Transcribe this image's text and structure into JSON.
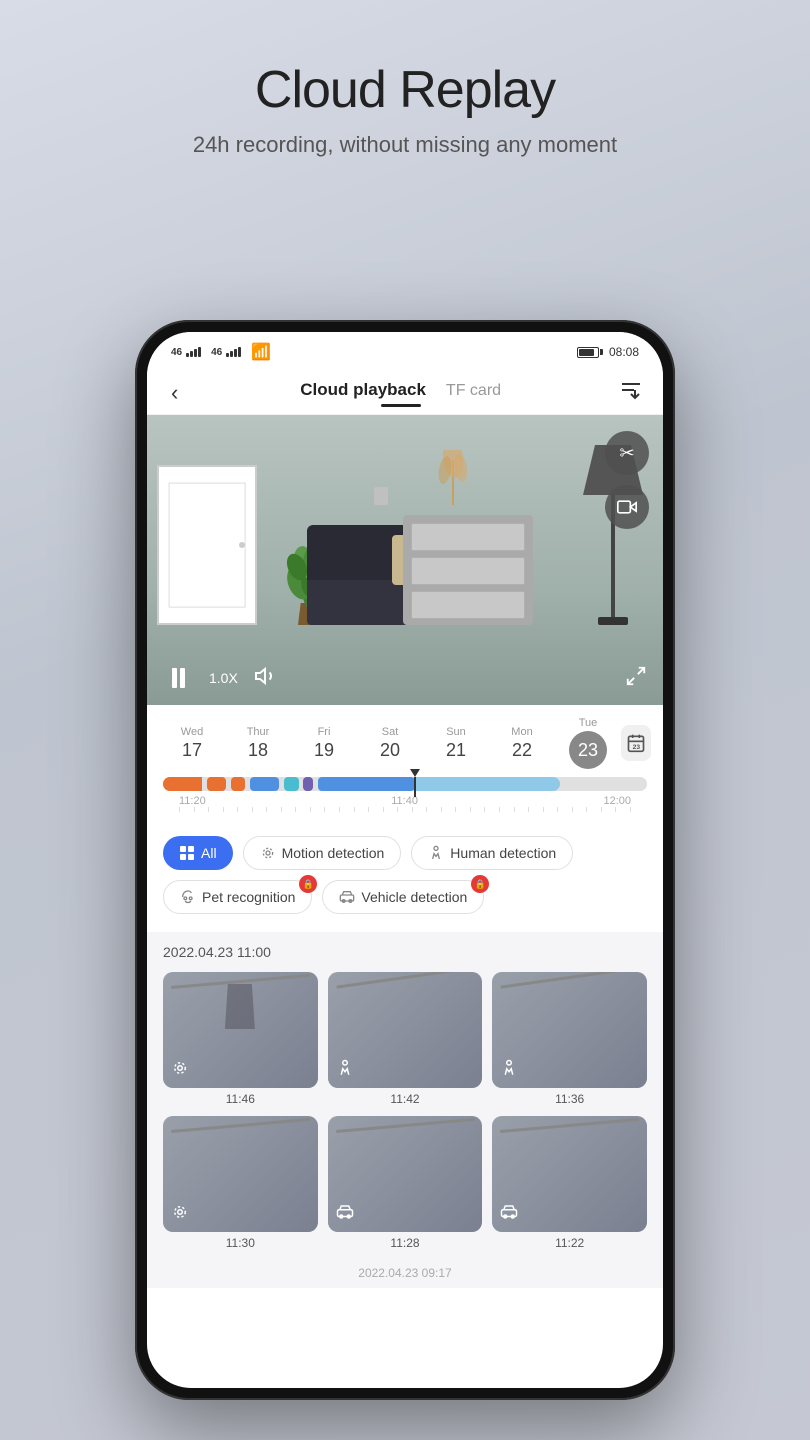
{
  "page": {
    "title": "Cloud Replay",
    "subtitle": "24h recording, without missing any moment"
  },
  "status_bar": {
    "network1": "46",
    "network2": "46",
    "wifi": "wifi",
    "time": "08:08"
  },
  "nav": {
    "back_label": "‹",
    "tab_active": "Cloud playback",
    "tab_inactive": "TF card",
    "sort_icon": "sort-download-icon"
  },
  "video": {
    "speed": "1.0X",
    "play_state": "paused"
  },
  "dates": [
    {
      "day": "Wed",
      "num": "17",
      "active": false
    },
    {
      "day": "Thur",
      "num": "18",
      "active": false
    },
    {
      "day": "Fri",
      "num": "19",
      "active": false
    },
    {
      "day": "Sat",
      "num": "20",
      "active": false
    },
    {
      "day": "Sun",
      "num": "21",
      "active": false
    },
    {
      "day": "Mon",
      "num": "22",
      "active": false
    },
    {
      "day": "Tue",
      "num": "23",
      "active": true
    }
  ],
  "timeline": {
    "current_time": "11:40",
    "time_left": "11:20",
    "time_right": "12:00"
  },
  "filters": [
    {
      "id": "all",
      "label": "All",
      "active": true,
      "locked": false
    },
    {
      "id": "motion",
      "label": "Motion detection",
      "active": false,
      "locked": false
    },
    {
      "id": "human",
      "label": "Human detection",
      "active": false,
      "locked": false
    },
    {
      "id": "pet",
      "label": "Pet recognition",
      "active": false,
      "locked": true
    },
    {
      "id": "vehicle",
      "label": "Vehicle detection",
      "active": false,
      "locked": true
    }
  ],
  "recordings": {
    "date_label": "2022.04.23  11:00",
    "items": [
      {
        "time": "11:46",
        "icon": "motion-icon"
      },
      {
        "time": "11:42",
        "icon": "human-icon"
      },
      {
        "time": "11:36",
        "icon": "human-icon"
      },
      {
        "time": "11:30",
        "icon": "motion-icon"
      },
      {
        "time": "11:28",
        "icon": "vehicle-icon"
      },
      {
        "time": "11:22",
        "icon": "vehicle-icon"
      }
    ]
  },
  "more_label": "2022.04.23  09:17"
}
